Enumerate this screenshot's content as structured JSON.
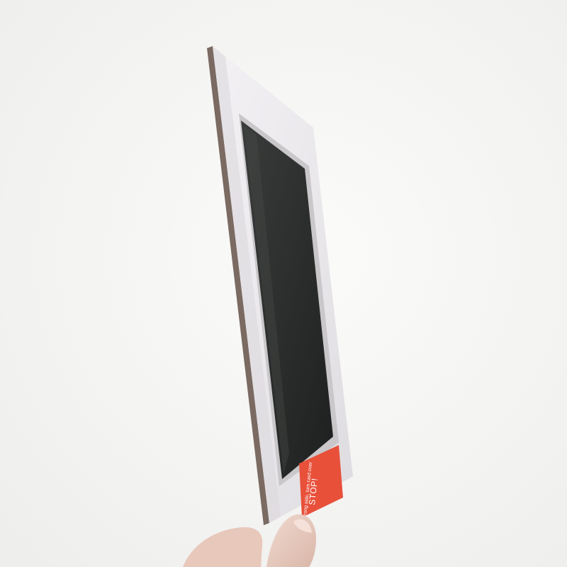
{
  "photo": {
    "subject": "handheld card with dark ink pad window",
    "background_color": "#f4f4f2",
    "card_face_color": "#ebe9ec",
    "card_edge_color": "#7a6a62",
    "pad_color": "#2a2c2b",
    "label_color": "#e8503a"
  },
  "label": {
    "title": "STOP!",
    "subtitle": "wrong side, turn card over"
  }
}
